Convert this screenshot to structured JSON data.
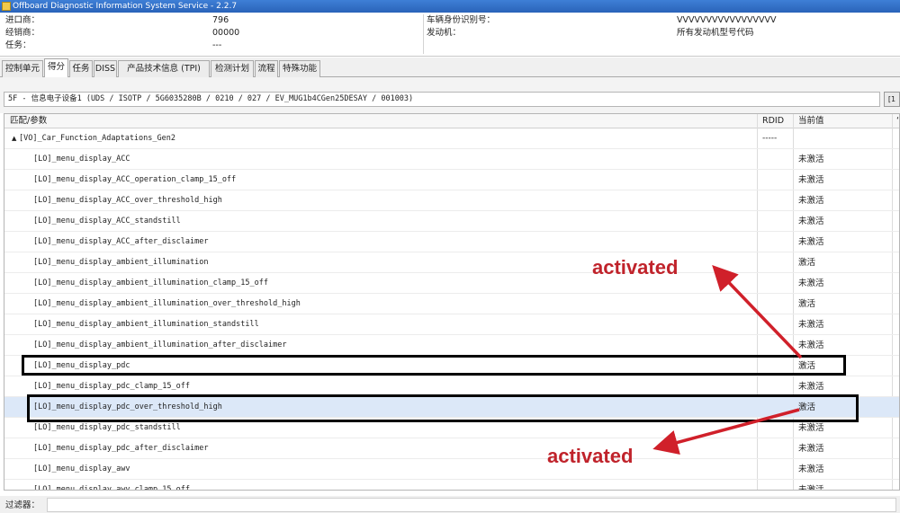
{
  "window": {
    "title": "Offboard Diagnostic Information System Service - 2.2.7"
  },
  "info": {
    "importer_label": "进口商：",
    "importer_value": "796",
    "dealer_label": "经销商：",
    "dealer_value": "00000",
    "task_label": "任务：",
    "task_value": "---",
    "vin_label": "车辆身份识别号：",
    "vin_value": "VVVVVVVVVVVVVVVVV",
    "engine_label": "发动机：",
    "engine_value": "所有发动机型号代码"
  },
  "tabs": [
    {
      "label": "控制单元"
    },
    {
      "label": "得分"
    },
    {
      "label": "任务"
    },
    {
      "label": "DISS"
    },
    {
      "label": "产品技术信息 (TPI)"
    },
    {
      "label": "检测计划"
    },
    {
      "label": "流程"
    },
    {
      "label": "特殊功能"
    }
  ],
  "path_text": "5F - 信息电子设备1  (UDS / ISOTP / 5G6035280B  / 0210 / 027 / EV_MUG1b4CGen25DESAY / 001003)",
  "path_button": "[1",
  "table": {
    "col_param": "匹配/参数",
    "col_rdid": "RDID",
    "col_value": "当前值",
    "col_extra": "‘",
    "group": {
      "name": "[VO]_Car_Function_Adaptations_Gen2",
      "rdid": "-----"
    },
    "rows": [
      {
        "name": "[LO]_menu_display_ACC",
        "value": "未激活"
      },
      {
        "name": "[LO]_menu_display_ACC_operation_clamp_15_off",
        "value": "未激活"
      },
      {
        "name": "[LO]_menu_display_ACC_over_threshold_high",
        "value": "未激活"
      },
      {
        "name": "[LO]_menu_display_ACC_standstill",
        "value": "未激活"
      },
      {
        "name": "[LO]_menu_display_ACC_after_disclaimer",
        "value": "未激活"
      },
      {
        "name": "[LO]_menu_display_ambient_illumination",
        "value": "激活"
      },
      {
        "name": "[LO]_menu_display_ambient_illumination_clamp_15_off",
        "value": "未激活"
      },
      {
        "name": "[LO]_menu_display_ambient_illumination_over_threshold_high",
        "value": "激活"
      },
      {
        "name": "[LO]_menu_display_ambient_illumination_standstill",
        "value": "未激活"
      },
      {
        "name": "[LO]_menu_display_ambient_illumination_after_disclaimer",
        "value": "未激活"
      },
      {
        "name": "[LO]_menu_display_pdc",
        "value": "激活"
      },
      {
        "name": "[LO]_menu_display_pdc_clamp_15_off",
        "value": "未激活"
      },
      {
        "name": "[LO]_menu_display_pdc_over_threshold_high",
        "value": "激活"
      },
      {
        "name": "[LO]_menu_display_pdc_standstill",
        "value": "未激活"
      },
      {
        "name": "[LO]_menu_display_pdc_after_disclaimer",
        "value": "未激活"
      },
      {
        "name": "[LO]_menu_display_awv",
        "value": "未激活"
      },
      {
        "name": "[LO]_menu_display_awv_clamp_15_off",
        "value": "未激活"
      }
    ]
  },
  "filter_label": "过滤器：",
  "annotations": {
    "upper": "activated",
    "lower": "activated",
    "color": "#c0232b"
  }
}
